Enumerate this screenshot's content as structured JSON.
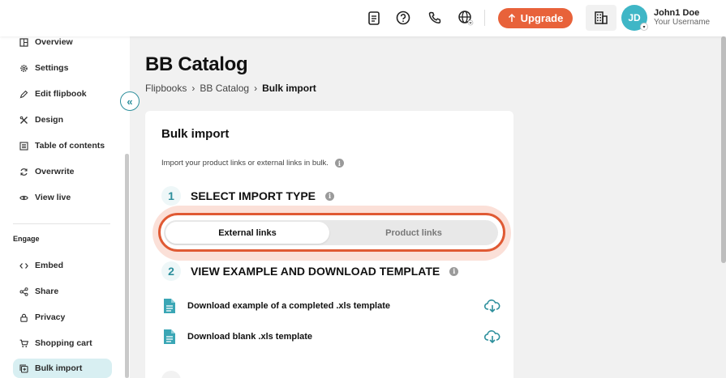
{
  "topbar": {
    "upgrade_label": "Upgrade",
    "avatar_initials": "JD",
    "user_name": "John1 Doe",
    "user_sub": "Your Username",
    "icons": [
      "document-icon",
      "help-icon",
      "phone-icon",
      "globe-icon",
      "building-icon"
    ]
  },
  "sidebar": {
    "items": [
      {
        "label": "Overview",
        "icon": "overview-icon"
      },
      {
        "label": "Settings",
        "icon": "gear-icon"
      },
      {
        "label": "Edit flipbook",
        "icon": "pencil-icon"
      },
      {
        "label": "Design",
        "icon": "design-icon"
      },
      {
        "label": "Table of contents",
        "icon": "toc-icon"
      },
      {
        "label": "Overwrite",
        "icon": "refresh-icon"
      },
      {
        "label": "View live",
        "icon": "eye-icon"
      }
    ],
    "section_engage": "Engage",
    "engage_items": [
      {
        "label": "Embed",
        "icon": "code-icon"
      },
      {
        "label": "Share",
        "icon": "share-icon"
      },
      {
        "label": "Privacy",
        "icon": "lock-icon"
      },
      {
        "label": "Shopping cart",
        "icon": "cart-icon"
      },
      {
        "label": "Bulk import",
        "icon": "bulk-import-icon",
        "active": true
      }
    ]
  },
  "main": {
    "title": "BB Catalog",
    "breadcrumb": [
      "Flipbooks",
      "BB Catalog",
      "Bulk import"
    ],
    "card": {
      "title": "Bulk import",
      "description": "Import your product links or external links in bulk.",
      "step1": {
        "num": "1",
        "label": "SELECT IMPORT TYPE"
      },
      "toggle": {
        "option1": "External links",
        "option2": "Product links",
        "selected": "External links"
      },
      "step2": {
        "num": "2",
        "label": "VIEW EXAMPLE AND DOWNLOAD TEMPLATE"
      },
      "downloads": [
        {
          "label": "Download example of a completed .xls template"
        },
        {
          "label": "Download blank .xls template"
        }
      ]
    }
  },
  "colors": {
    "accent": "#e8623a",
    "teal": "#2d8f9c",
    "avatar": "#3fb6c6"
  }
}
